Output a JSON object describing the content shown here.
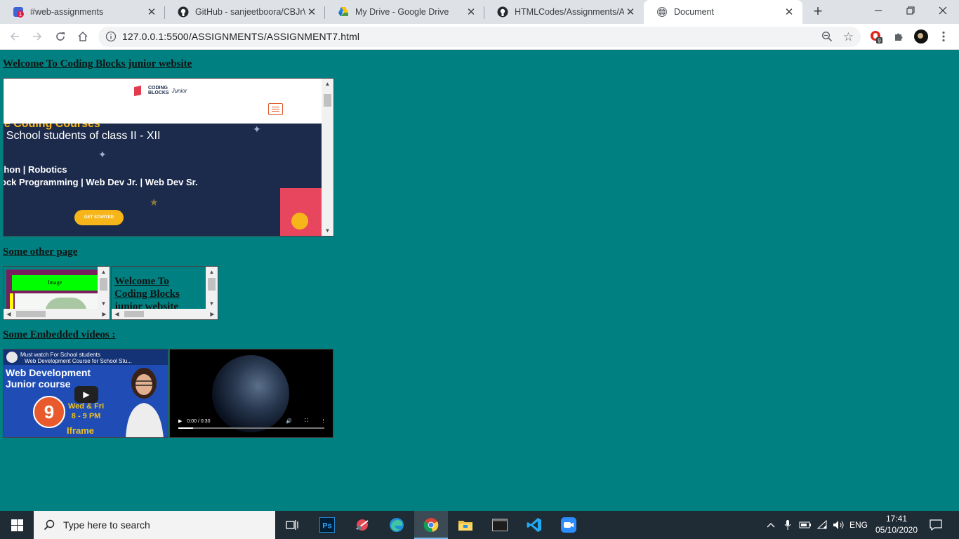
{
  "browser": {
    "tabs": [
      {
        "title": "#web-assignments",
        "badge": "1"
      },
      {
        "title": "GitHub - sanjeetboora/CBJrWe"
      },
      {
        "title": "My Drive - Google Drive"
      },
      {
        "title": "HTMLCodes/Assignments/Assi"
      },
      {
        "title": "Document"
      }
    ],
    "url": "127.0.0.1:5500/ASSIGNMENTS/ASSIGNMENT7.html",
    "extension_badge": "9"
  },
  "page": {
    "heading1": "Welcome To Coding Blocks junior website",
    "heading2": "Some other page",
    "heading3": "Some Embedded videos :",
    "cb_site": {
      "logo_line1": "CODING",
      "logo_line2": "BLOCKS",
      "logo_junior": "Junior",
      "hero_line1": "ee Coding Courses",
      "hero_line2": "r School students of class II - XII",
      "hero_line3": "thon | Robotics",
      "hero_line4": "ock Programming | Web Dev Jr. | Web Dev Sr.",
      "cta": "GET STARTED"
    },
    "nested_frame1": {
      "label": "Image"
    },
    "nested_frame2": {
      "text": "Welcome To Coding Blocks junior website"
    },
    "youtube": {
      "line1": "Must watch For School students",
      "line2": "Web Development Course for School Stu...",
      "title_line1": "Web Development",
      "title_line2": "Junior course",
      "badge": "9",
      "day": "Wed & Fri",
      "time": "8 - 9 PM",
      "caption": "Iframe"
    },
    "video": {
      "time": "0:00 / 0:30",
      "progress": 0.1
    }
  },
  "taskbar": {
    "search_placeholder": "Type here to search",
    "language": "ENG",
    "time": "17:41",
    "date": "05/10/2020"
  }
}
